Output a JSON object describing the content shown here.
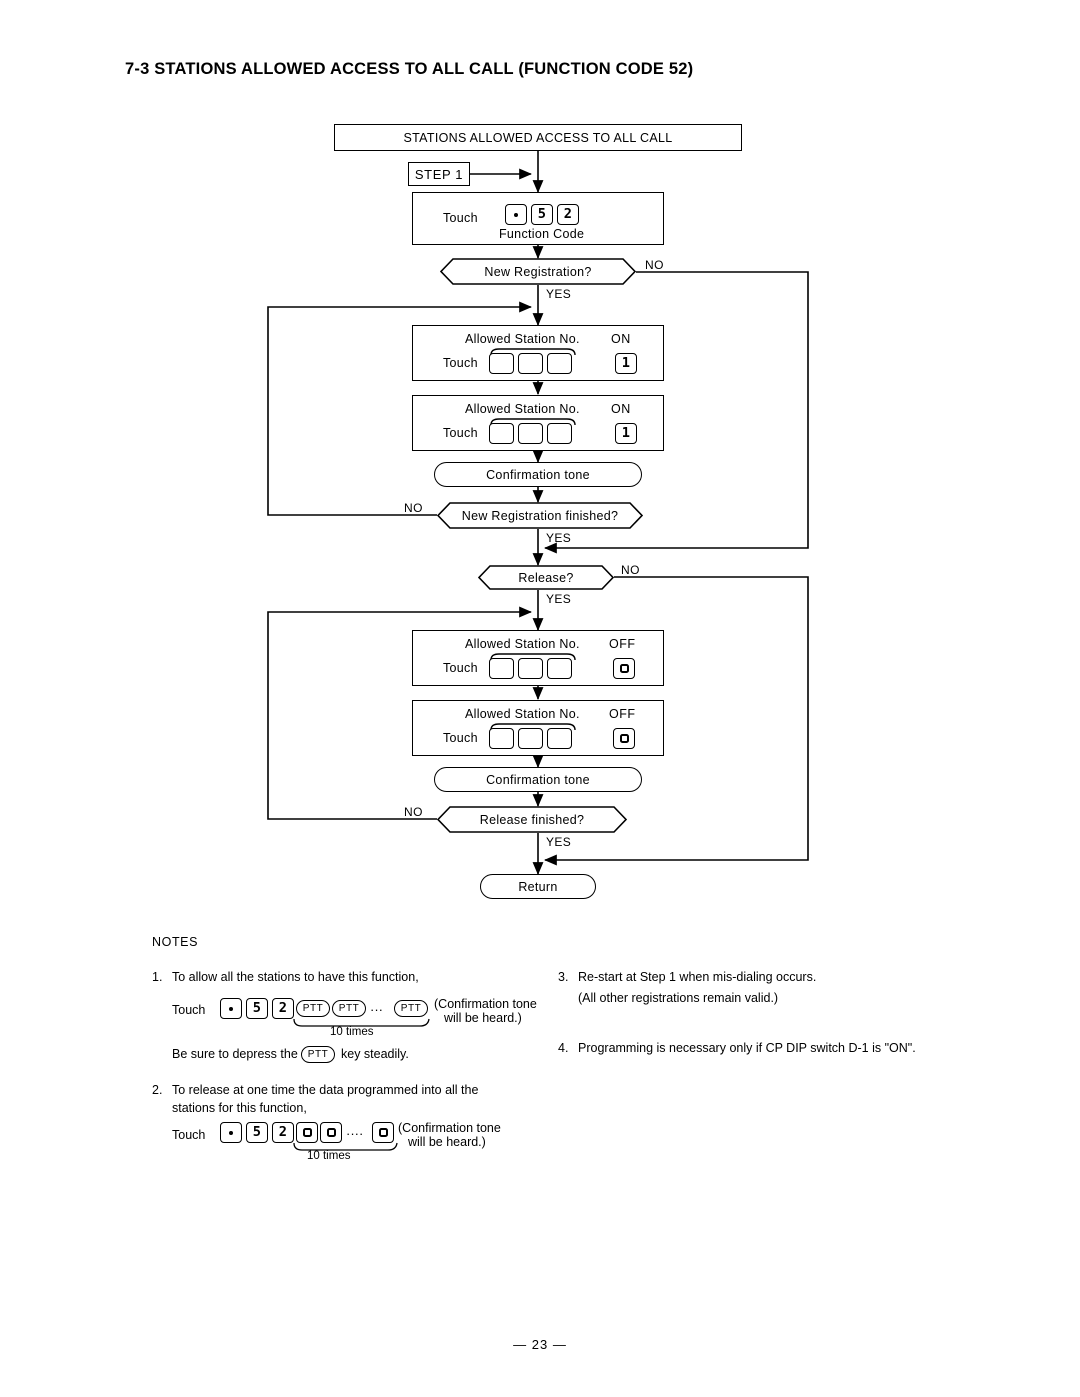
{
  "document": {
    "section_title": "7-3 STATIONS ALLOWED ACCESS TO ALL CALL (FUNCTION CODE 52)",
    "page_number": "— 23 —"
  },
  "flowchart": {
    "title_box": "STATIONS ALLOWED ACCESS TO ALL CALL",
    "step_box": "STEP 1",
    "function_code_box": {
      "touch_label": "Touch",
      "caption": "Function Code",
      "keys": [
        "•",
        "5",
        "2"
      ]
    },
    "decisions": {
      "new_registration": "New Registration?",
      "new_registration_finished": "New Registration finished?",
      "release": "Release?",
      "release_finished": "Release finished?"
    },
    "branch_labels": {
      "yes": "YES",
      "no": "NO"
    },
    "register_step_1": {
      "caption": "Allowed Station No.",
      "touch_label": "Touch",
      "state_label": "ON",
      "state_key": "1",
      "station_keys": [
        "",
        "",
        ""
      ]
    },
    "register_step_2": {
      "caption": "Allowed Station No.",
      "touch_label": "Touch",
      "state_label": "ON",
      "state_key": "1",
      "station_keys": [
        "",
        "",
        ""
      ]
    },
    "release_step_1": {
      "caption": "Allowed Station No.",
      "touch_label": "Touch",
      "state_label": "OFF",
      "state_key": "0",
      "station_keys": [
        "",
        "",
        ""
      ]
    },
    "release_step_2": {
      "caption": "Allowed Station No.",
      "touch_label": "Touch",
      "state_label": "OFF",
      "state_key": "0",
      "station_keys": [
        "",
        "",
        ""
      ]
    },
    "confirmation_tone_1": "Confirmation tone",
    "confirmation_tone_2": "Confirmation tone",
    "return_terminator": "Return"
  },
  "notes": {
    "heading": "NOTES",
    "note1": {
      "number": "1.",
      "text": "To allow all the stations to have this function,",
      "touch_label": "Touch",
      "keys": [
        "•",
        "5",
        "2"
      ],
      "ptt_keys": [
        "PTT",
        "PTT",
        "PTT"
      ],
      "ellipsis": "···",
      "times_label": "10 times",
      "paren_line1": "(Confirmation tone",
      "paren_line2": "will be heard.)",
      "footer_pre": "Be sure to depress the",
      "footer_key": "PTT",
      "footer_post": "key steadily."
    },
    "note2": {
      "number": "2.",
      "text_line1": "To release at one time the data programmed into all the",
      "text_line2": "stations for this function,",
      "touch_label": "Touch",
      "keys": [
        "•",
        "5",
        "2"
      ],
      "zero_keys": [
        "0",
        "0",
        "0"
      ],
      "ellipsis": "····",
      "times_label": "10 times",
      "paren_line1": "(Confirmation tone",
      "paren_line2": "will be heard.)"
    },
    "note3": {
      "number": "3.",
      "text_line1": "Re-start at Step 1  when mis-dialing occurs.",
      "text_line2": "(All other registrations remain valid.)"
    },
    "note4": {
      "number": "4.",
      "text_line1": "Programming is necessary only if CP DIP switch D-1 is \"ON\"."
    }
  }
}
